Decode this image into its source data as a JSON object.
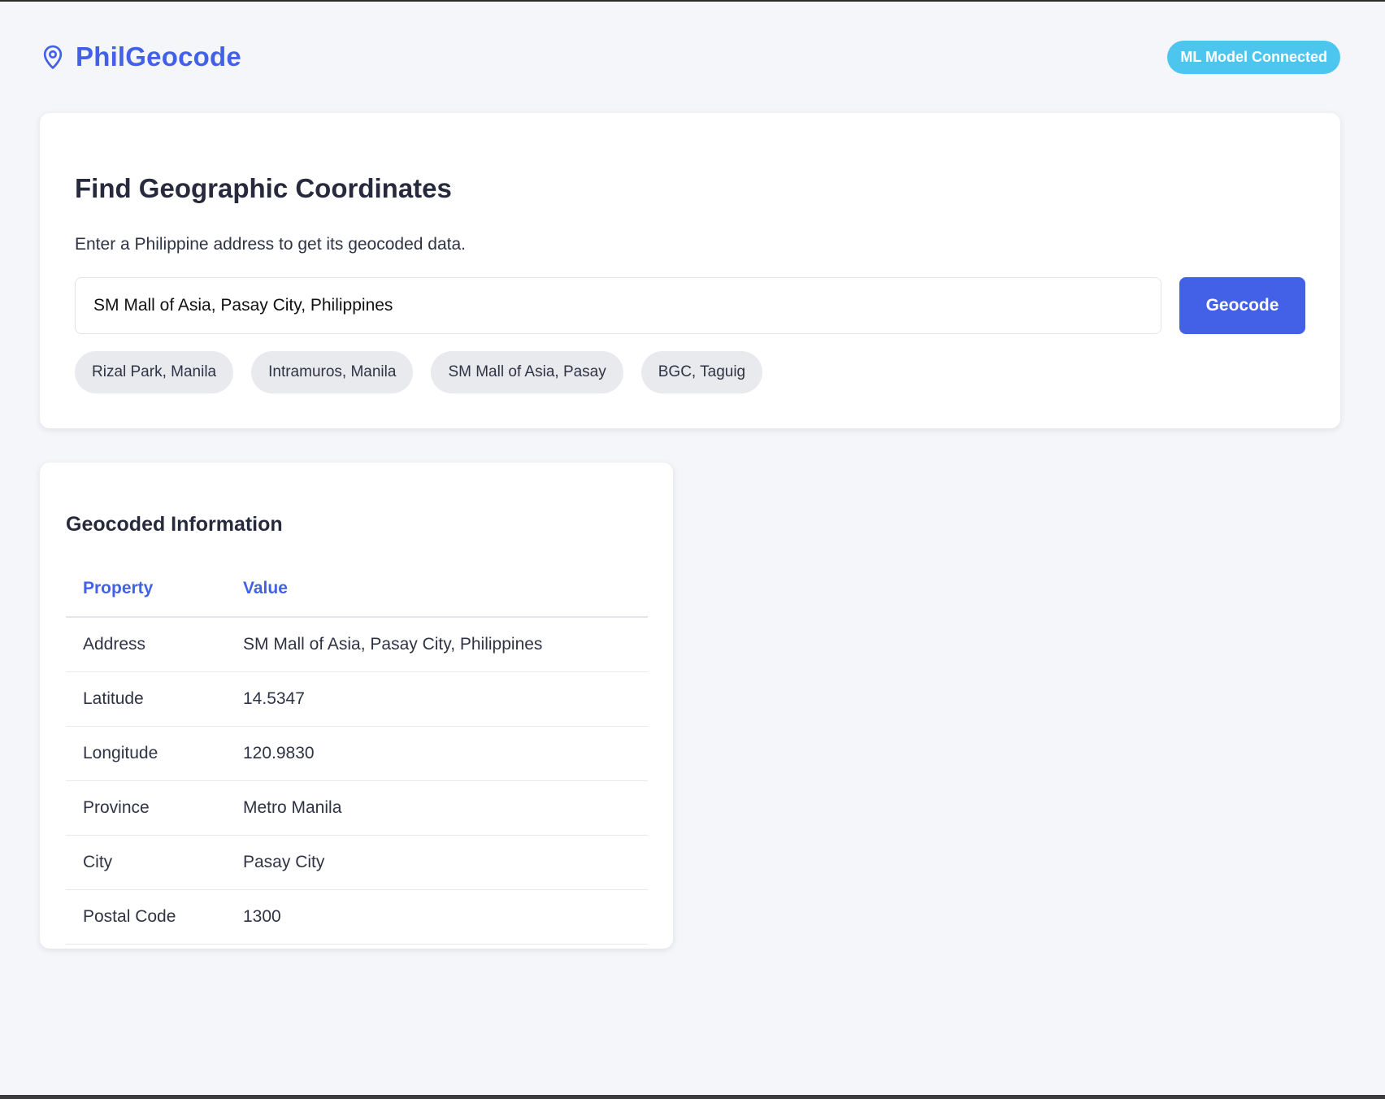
{
  "app": {
    "title": "PhilGeocode",
    "icon": "map-pin-icon",
    "status": "ML Model Connected",
    "accent_color": "#4361e6",
    "status_color": "#4dc6ef"
  },
  "search": {
    "title": "Find Geographic Coordinates",
    "description": "Enter a Philippine address to get its geocoded data.",
    "input_value": "SM Mall of Asia, Pasay City, Philippines",
    "button_label": "Geocode",
    "suggestions": [
      "Rizal Park, Manila",
      "Intramuros, Manila",
      "SM Mall of Asia, Pasay",
      "BGC, Taguig"
    ]
  },
  "results": {
    "title": "Geocoded Information",
    "columns": [
      "Property",
      "Value"
    ],
    "rows": [
      {
        "property": "Address",
        "value": "SM Mall of Asia, Pasay City, Philippines"
      },
      {
        "property": "Latitude",
        "value": "14.5347"
      },
      {
        "property": "Longitude",
        "value": "120.9830"
      },
      {
        "property": "Province",
        "value": "Metro Manila"
      },
      {
        "property": "City",
        "value": "Pasay City"
      },
      {
        "property": "Postal Code",
        "value": "1300"
      }
    ]
  }
}
